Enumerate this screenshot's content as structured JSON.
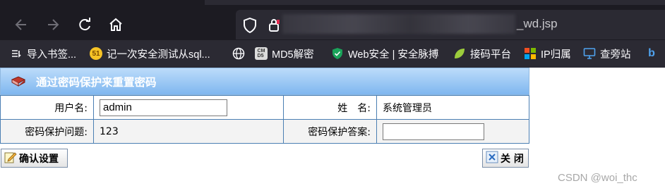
{
  "browser": {
    "url_suffix": "_wd.jsp",
    "bookmarks": [
      {
        "label": "导入书签..."
      },
      {
        "label": "记一次安全测试从sql..."
      },
      {
        "label": ""
      },
      {
        "label": "MD5解密"
      },
      {
        "label": "Web安全 | 安全脉搏"
      },
      {
        "label": "接码平台"
      },
      {
        "label": "IP归属"
      },
      {
        "label": "查旁站"
      }
    ]
  },
  "panel": {
    "title": "通过密码保护来重置密码"
  },
  "form": {
    "username_label": "用户名:",
    "username_value": "admin",
    "name_label": "姓　名:",
    "name_value": "系统管理员",
    "question_label": "密码保护问题:",
    "question_value": "123",
    "answer_label": "密码保护答案:",
    "answer_value": ""
  },
  "buttons": {
    "confirm": "确认设置",
    "close": "关 闭"
  },
  "watermark": "CSDN @woi_thc"
}
